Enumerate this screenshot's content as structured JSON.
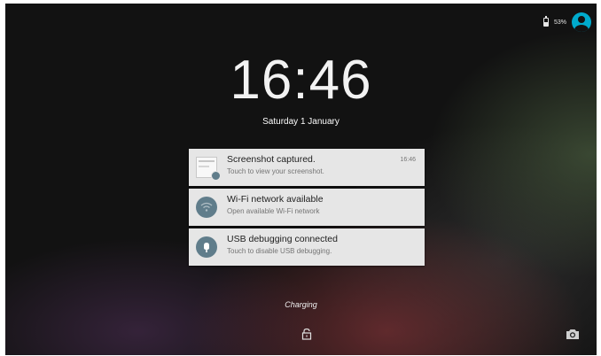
{
  "status_bar": {
    "battery_percent": "53%",
    "battery_level": 0.53,
    "icons": [
      "battery-icon",
      "user-avatar-icon"
    ]
  },
  "lockscreen": {
    "time": "16:46",
    "date": "Saturday 1 January",
    "charging_label": "Charging"
  },
  "notifications": [
    {
      "icon": "screenshot-thumbnail-icon",
      "title": "Screenshot captured.",
      "subtitle": "Touch to view your screenshot.",
      "time": "16:46"
    },
    {
      "icon": "wifi-icon",
      "title": "Wi-Fi network available",
      "subtitle": "Open available Wi-Fi network"
    },
    {
      "icon": "usb-debug-icon",
      "title": "USB debugging connected",
      "subtitle": "Touch to disable USB debugging."
    }
  ],
  "bottom_icons": [
    "lock-icon",
    "camera-icon"
  ],
  "colors": {
    "accent": "#00aacc",
    "card_bg": "#e6e6e6",
    "icon_circle": "#607d8b"
  }
}
